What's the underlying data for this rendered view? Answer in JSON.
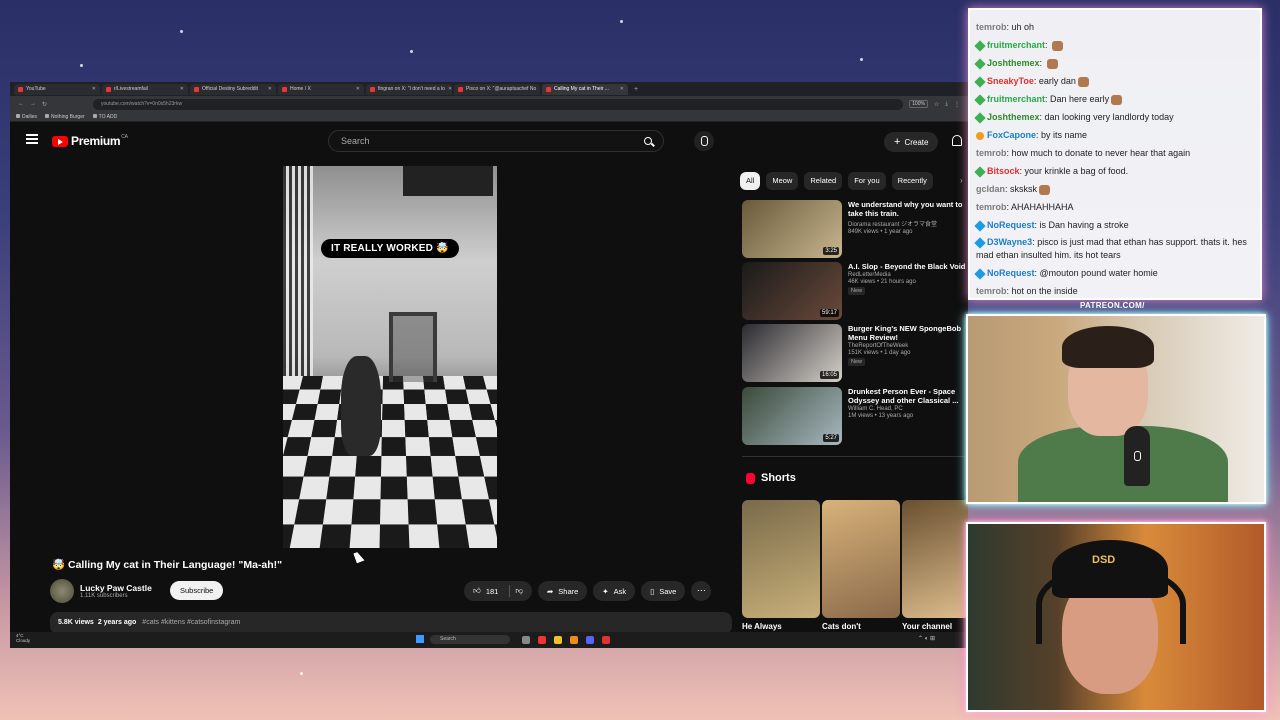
{
  "browser": {
    "tabs": [
      {
        "label": "YouTube",
        "active": false
      },
      {
        "label": "r/Livestreamfail",
        "active": false
      },
      {
        "label": "Official Destiny Subreddit",
        "active": false
      },
      {
        "label": "Home / X",
        "active": false
      },
      {
        "label": "fingran on X: \"I don't need a lo",
        "active": false
      },
      {
        "label": "Pisco on X: \"@auraptsachef No",
        "active": false
      },
      {
        "label": "Calling My cat in Their ...",
        "active": true
      }
    ],
    "url": "youtube.com/watch?v=0n0s5h23rkw",
    "zoom": "100%",
    "bookmarks": [
      "Dailies",
      "Nothing Burger",
      "TO ADD"
    ]
  },
  "yt": {
    "logo_text": "Premium",
    "region": "CA",
    "search_placeholder": "Search",
    "create_label": "Create"
  },
  "video": {
    "caption": "IT REALLY WORKED 🤯",
    "title": "🤯 Calling My cat in Their Language! \"Ma-ah!\"",
    "channel": "Lucky Paw Castle",
    "subscribers": "1.11K subscribers",
    "subscribe_label": "Subscribe",
    "likes": "181",
    "share_label": "Share",
    "ask_label": "Ask",
    "save_label": "Save",
    "more_label": "⋯",
    "views": "5.8K views",
    "age": "2 years ago",
    "tags": "#cats #kittens #catsofinstagram"
  },
  "chips": [
    "All",
    "Meow",
    "Related",
    "For you",
    "Recently"
  ],
  "recommendations": [
    {
      "title": "We understand why you want to take this train.",
      "channel": "Diorama restaurant ジオラマ食堂",
      "meta": "849K views • 1 year ago",
      "duration": "3:25",
      "badge": "",
      "colors": [
        "#6b5a3a",
        "#c7b68f"
      ]
    },
    {
      "title": "A.I. Slop - Beyond the Black Void",
      "channel": "RedLetterMedia",
      "meta": "46K views • 21 hours ago",
      "duration": "59:17",
      "badge": "New",
      "colors": [
        "#1a1a1a",
        "#6a4a3a"
      ]
    },
    {
      "title": "Burger King's NEW SpongeBob Menu Review!",
      "channel": "TheReportOfTheWeek",
      "meta": "151K views • 1 day ago",
      "duration": "16:05",
      "badge": "New",
      "colors": [
        "#2a2a30",
        "#d6d0c8"
      ]
    },
    {
      "title": "Drunkest Person Ever - Space Odyssey and other Classical ...",
      "channel": "William C. Head, PC",
      "meta": "1M views • 13 years ago",
      "duration": "5:27",
      "badge": "",
      "colors": [
        "#3a4a3a",
        "#a8b8c0"
      ]
    }
  ],
  "shorts": {
    "heading": "Shorts",
    "items": [
      {
        "title": "He Always",
        "colors": [
          "#7a6a4a",
          "#c8b07a"
        ]
      },
      {
        "title": "Cats don't",
        "colors": [
          "#d8b27a",
          "#8a6a4a"
        ]
      },
      {
        "title": "Your channel",
        "colors": [
          "#6a5030",
          "#e0c090"
        ]
      }
    ]
  },
  "taskbar": {
    "weather_temp": "4°C",
    "weather_desc": "Cloudy",
    "search_label": "Search"
  },
  "chat": [
    {
      "user": "temrob",
      "text": "uh oh",
      "color": "grey",
      "badge": ""
    },
    {
      "user": "fruitmerchant",
      "text": "",
      "color": "tp",
      "badge": "green",
      "emote": true
    },
    {
      "user": "Joshthemex",
      "text": "",
      "color": "green",
      "badge": "green",
      "emote": true
    },
    {
      "user": "SneakyToe",
      "text": "early dan",
      "color": "red",
      "badge": "green",
      "emote": true
    },
    {
      "user": "fruitmerchant",
      "text": "Dan here early",
      "color": "tp",
      "badge": "green",
      "emote": true
    },
    {
      "user": "Joshthemex",
      "text": "dan looking very landlordy today",
      "color": "green",
      "badge": "green",
      "emote": false
    },
    {
      "user": "FoxCapone",
      "text": "by its name",
      "color": "blue",
      "badge": "or",
      "emote": false
    },
    {
      "user": "temrob",
      "text": "how much to donate to never hear that again",
      "color": "grey",
      "badge": "",
      "emote": false
    },
    {
      "user": "Bitsock",
      "text": "your krinkle a bag of food.",
      "color": "red",
      "badge": "green",
      "emote": false
    },
    {
      "user": "gcldan",
      "text": "sksksk",
      "color": "grey",
      "badge": "",
      "emote": true
    },
    {
      "user": "temrob",
      "text": "AHAHAHHAHA",
      "color": "grey",
      "badge": "",
      "emote": false
    },
    {
      "user": "NoRequest",
      "text": "is Dan having a stroke",
      "color": "blue",
      "badge": "blue",
      "emote": false
    },
    {
      "user": "D3Wayne3",
      "text": "pisco is just mad that ethan has support. thats it. hes mad ethan insulted him. its hot tears",
      "color": "blue",
      "badge": "blue",
      "emote": false
    },
    {
      "user": "NoRequest",
      "text": "@mouton pound water homie",
      "color": "blue",
      "badge": "blue",
      "emote": false
    },
    {
      "user": "temrob",
      "text": "hot on the inside",
      "color": "grey",
      "badge": "",
      "emote": false
    }
  ],
  "overlay": {
    "patreon": "PATREON.COM/",
    "cap_text": "DSD"
  }
}
